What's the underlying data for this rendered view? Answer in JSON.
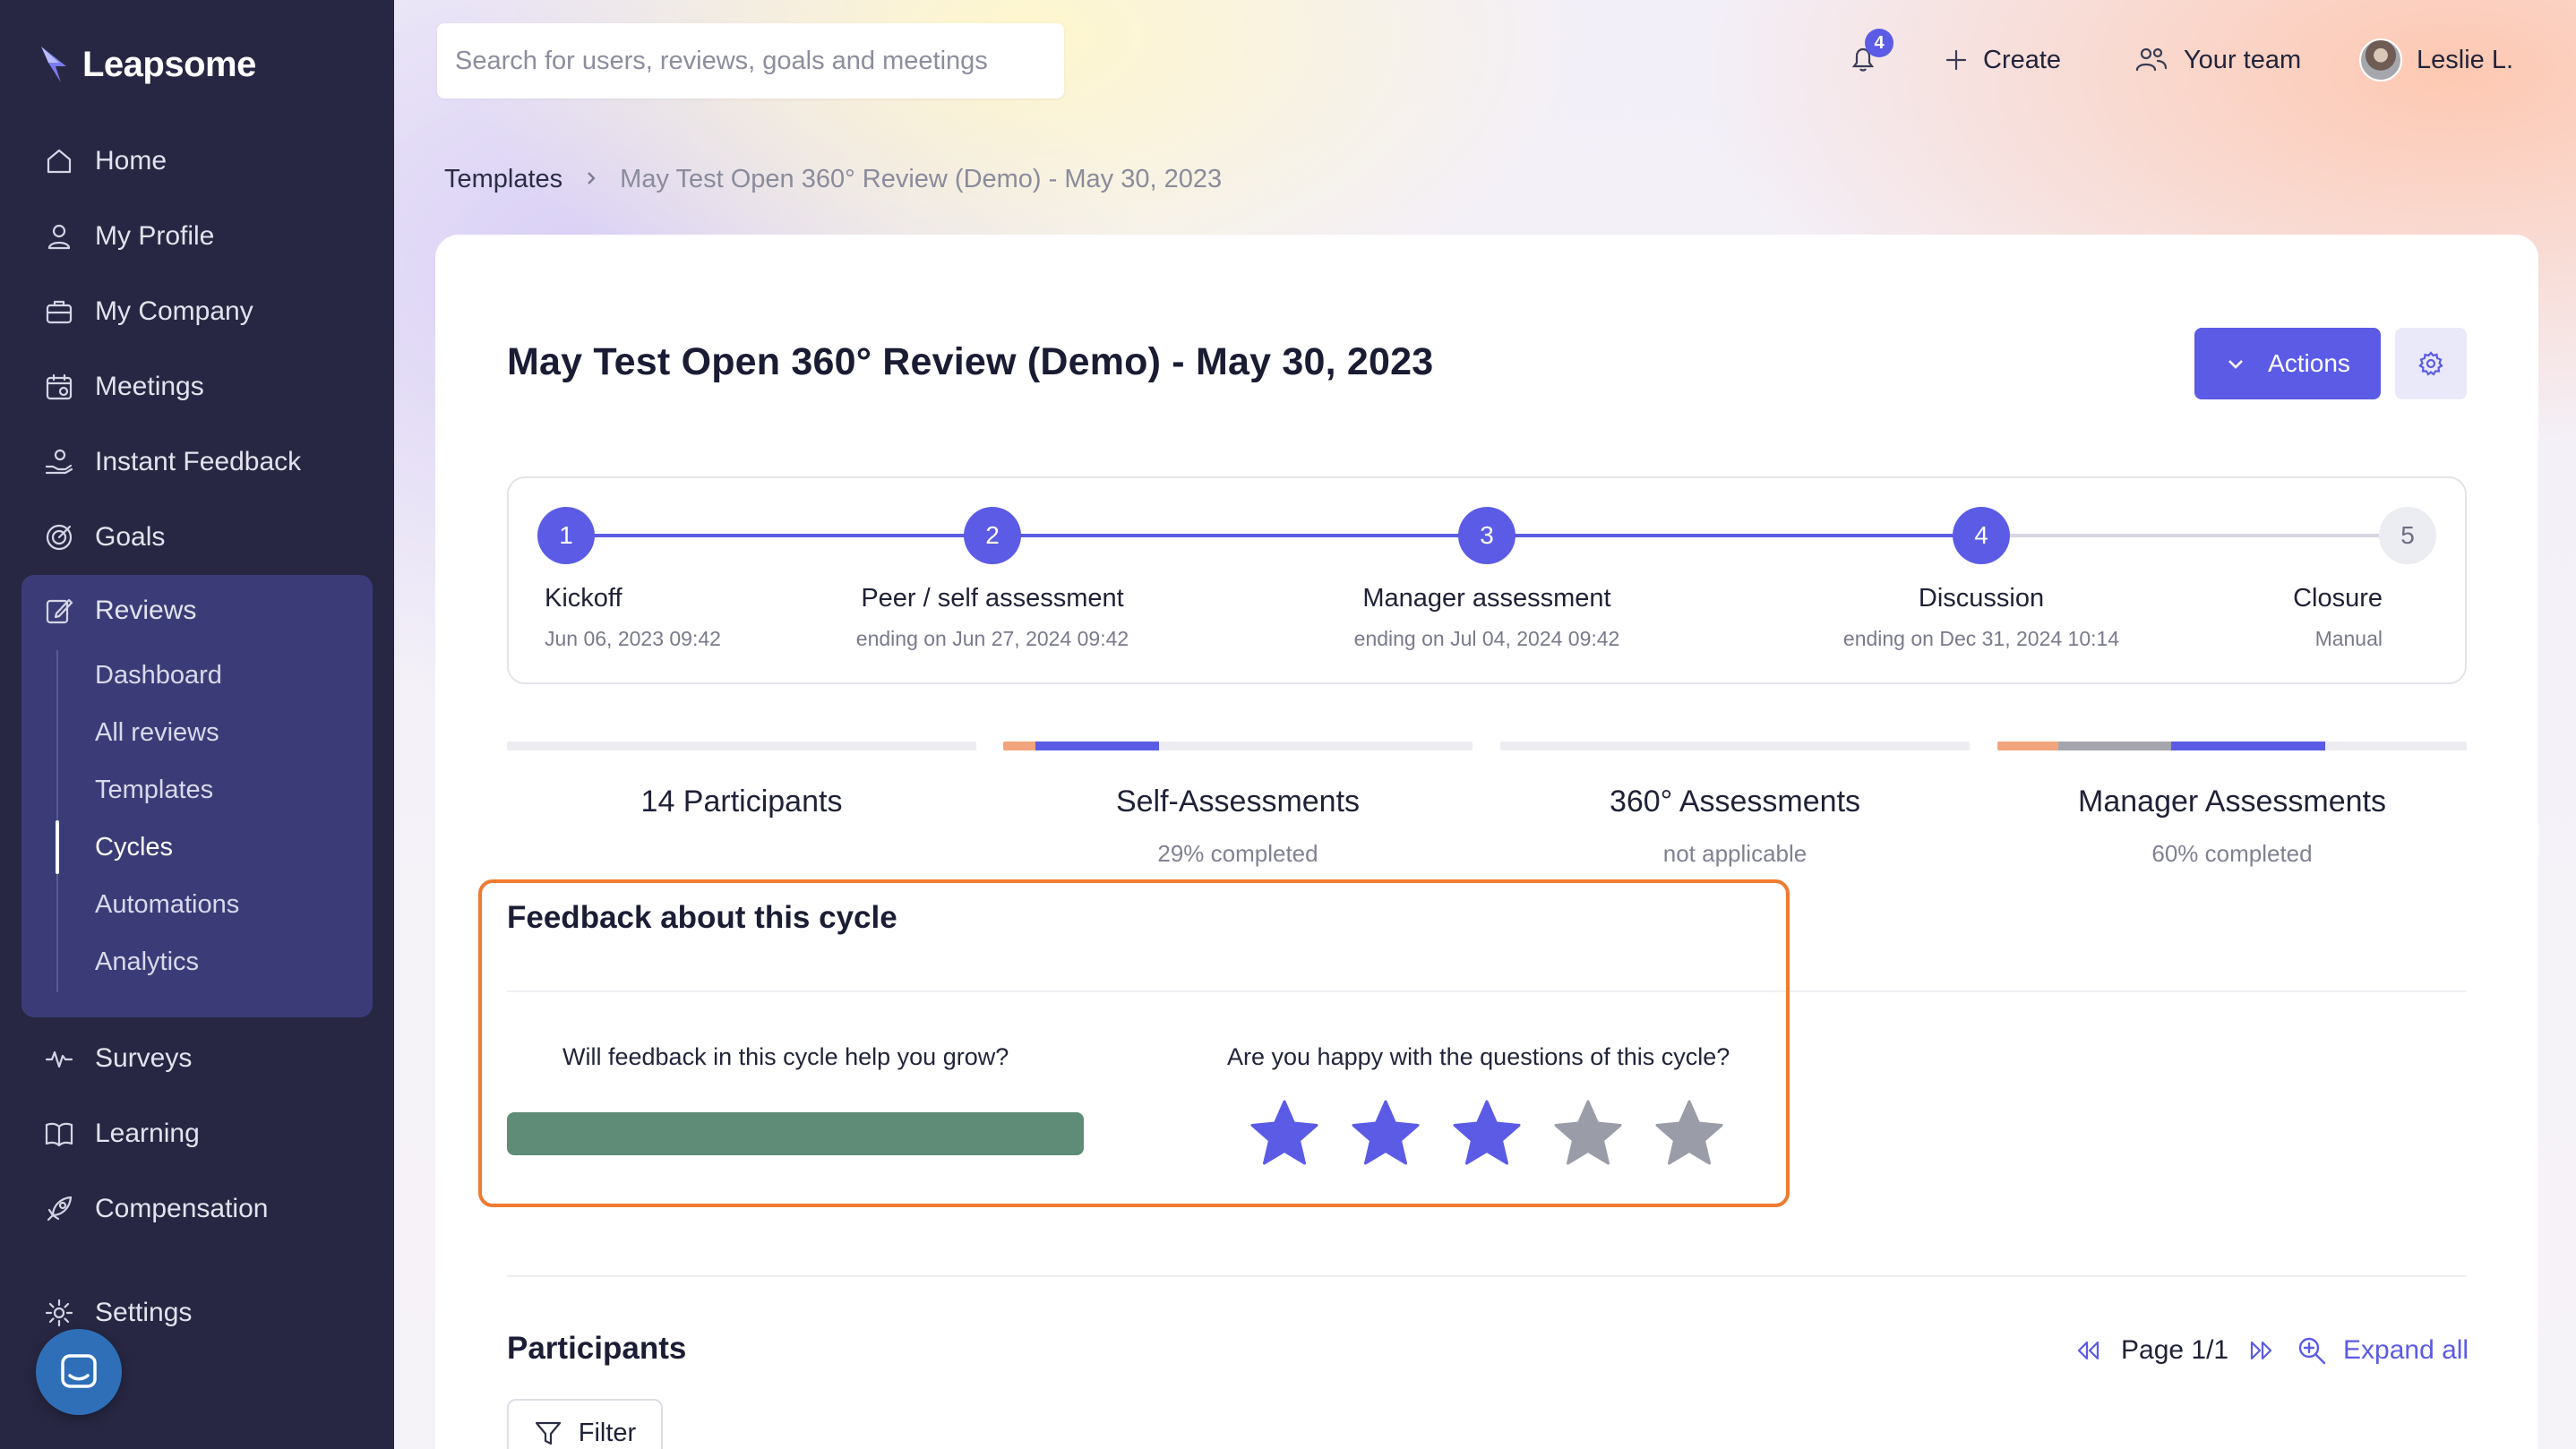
{
  "app": {
    "logo_text": "Leapsome",
    "colors": {
      "accent": "#5b5be6",
      "sidebar": "#272743",
      "highlight": "#f07a2f",
      "positive": "#5e8c76"
    }
  },
  "sidebar": {
    "items": [
      {
        "label": "Home",
        "icon": "home-icon"
      },
      {
        "label": "My Profile",
        "icon": "user-icon"
      },
      {
        "label": "My Company",
        "icon": "briefcase-icon"
      },
      {
        "label": "Meetings",
        "icon": "calendar-icon"
      },
      {
        "label": "Instant Feedback",
        "icon": "feedback-hand-icon"
      },
      {
        "label": "Goals",
        "icon": "target-icon"
      },
      {
        "label": "Reviews",
        "icon": "edit-icon"
      },
      {
        "label": "Surveys",
        "icon": "pulse-icon"
      },
      {
        "label": "Learning",
        "icon": "book-icon"
      },
      {
        "label": "Compensation",
        "icon": "rocket-icon"
      },
      {
        "label": "Settings",
        "icon": "gear-icon"
      }
    ],
    "reviews_sub": [
      "Dashboard",
      "All reviews",
      "Templates",
      "Cycles",
      "Automations",
      "Analytics"
    ],
    "active_sub": "Cycles"
  },
  "topbar": {
    "search_placeholder": "Search for users, reviews, goals and meetings",
    "notification_count": "4",
    "create_label": "Create",
    "team_label": "Your team",
    "user_name": "Leslie L."
  },
  "breadcrumb": {
    "parent": "Templates",
    "current": "May Test Open 360° Review (Demo) - May 30, 2023"
  },
  "page": {
    "title": "May Test Open 360° Review (Demo) - May 30, 2023",
    "actions_label": "Actions"
  },
  "stepper": {
    "completed_through": 4,
    "steps": [
      {
        "num": "1",
        "label": "Kickoff",
        "sub": "Jun 06, 2023 09:42"
      },
      {
        "num": "2",
        "label": "Peer / self assessment",
        "sub": "ending on Jun 27, 2024 09:42"
      },
      {
        "num": "3",
        "label": "Manager assessment",
        "sub": "ending on Jul 04, 2024 09:42"
      },
      {
        "num": "4",
        "label": "Discussion",
        "sub": "ending on Dec 31, 2024 10:14"
      },
      {
        "num": "5",
        "label": "Closure",
        "sub": "Manual"
      }
    ]
  },
  "stats": [
    {
      "title": "14 Participants",
      "sub": ""
    },
    {
      "title": "Self-Assessments",
      "sub": "29% completed"
    },
    {
      "title": "360° Assessments",
      "sub": "not applicable"
    },
    {
      "title": "Manager Assessments",
      "sub": "60% completed"
    }
  ],
  "feedback": {
    "title": "Feedback about this cycle",
    "question_grow": "Will feedback in this cycle help you grow?",
    "question_happy": "Are you happy with the questions of this cycle?",
    "rating": 3,
    "max_rating": 5
  },
  "participants": {
    "title": "Participants",
    "page_label": "Page 1/1",
    "expand_label": "Expand all",
    "filter_label": "Filter"
  }
}
